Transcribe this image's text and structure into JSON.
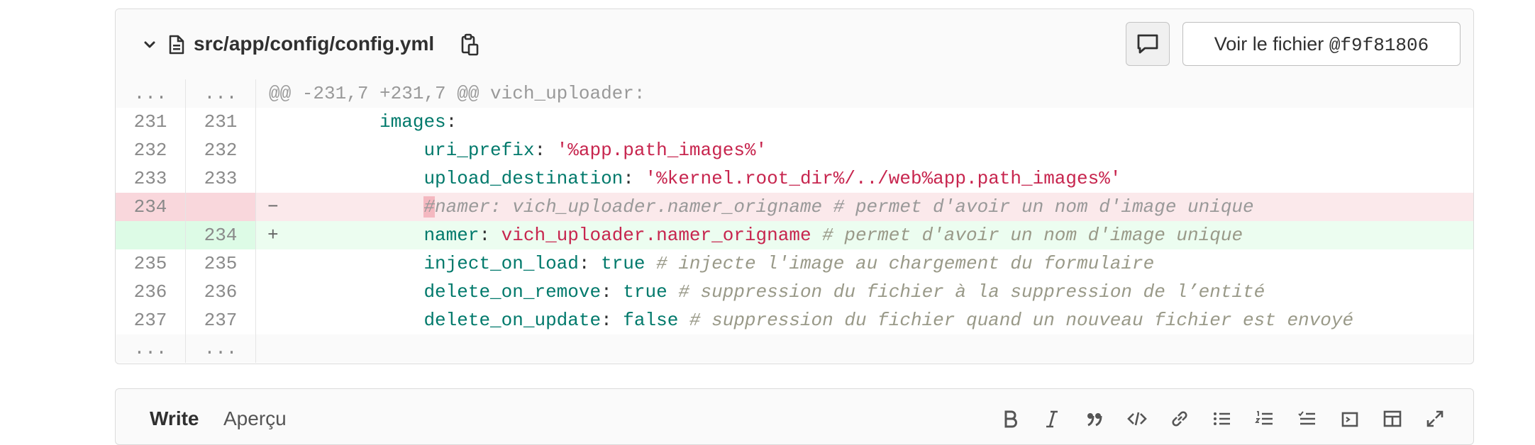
{
  "file": {
    "path": "src/app/config/config.yml",
    "view_button": {
      "prefix": "Voir le fichier ",
      "ref": "@f9f81806"
    }
  },
  "diff": {
    "hunk": {
      "old": "...",
      "new": "...",
      "header": "@@ -231,7 +231,7 @@ vich_uploader:"
    },
    "lines": [
      {
        "old": "231",
        "new": "231",
        "type": "context"
      },
      {
        "old": "232",
        "new": "232",
        "type": "context"
      },
      {
        "old": "233",
        "new": "233",
        "type": "context"
      },
      {
        "old": "234",
        "new": "",
        "type": "removed",
        "sign": "−"
      },
      {
        "old": "",
        "new": "234",
        "type": "added",
        "sign": "+"
      },
      {
        "old": "235",
        "new": "235",
        "type": "context"
      },
      {
        "old": "236",
        "new": "236",
        "type": "context"
      },
      {
        "old": "237",
        "new": "237",
        "type": "context"
      }
    ],
    "code": {
      "l231": {
        "key": "images",
        "colon": ":"
      },
      "l232": {
        "key": "uri_prefix",
        "colon": ": ",
        "value": "'%app.path_images%'"
      },
      "l233": {
        "key": "upload_destination",
        "colon": ": ",
        "value": "'%kernel.root_dir%/../web%app.path_images%'"
      },
      "l234_old": {
        "hash": "#",
        "rest": "namer: vich_uploader.namer_origname # permet d'avoir un nom d'image unique"
      },
      "l234_new": {
        "key": "namer",
        "colon": ": ",
        "value": "vich_uploader.namer_origname",
        "comment": " # permet d'avoir un nom d'image unique"
      },
      "l235": {
        "key": "inject_on_load",
        "colon": ": ",
        "value": "true",
        "comment": " # injecte l'image au chargement du formulaire"
      },
      "l236": {
        "key": "delete_on_remove",
        "colon": ": ",
        "value": "true",
        "comment": " # suppression du fichier à la suppression de l’entité"
      },
      "l237": {
        "key": "delete_on_update",
        "colon": ": ",
        "value": "false",
        "comment": " # suppression du fichier quand un nouveau fichier est envoyé"
      }
    },
    "footer": {
      "old": "...",
      "new": "..."
    }
  },
  "editor": {
    "tabs": {
      "write": "Write",
      "preview": "Aperçu"
    }
  },
  "colors": {
    "removed_bg": "#fbe9eb",
    "added_bg": "#ecfdf0",
    "key": "#00796b",
    "string": "#c7254e"
  }
}
